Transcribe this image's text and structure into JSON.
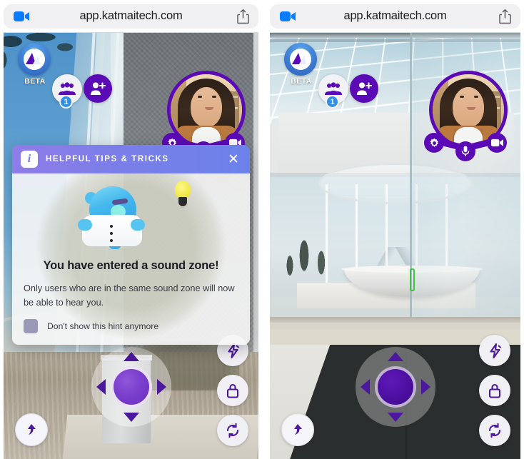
{
  "browser": {
    "url": "app.katmaitech.com",
    "camera_icon": "video-camera-icon",
    "share_icon": "share-icon"
  },
  "hud": {
    "brand_label": "BETA",
    "brand_icon": "mountain-logo-icon",
    "people_icon": "people-group-icon",
    "people_count": "1",
    "invite_icon": "add-person-icon",
    "selfview_label": "self-view-video",
    "controls": [
      {
        "name": "settings-button",
        "icon": "gear-icon"
      },
      {
        "name": "microphone-button",
        "icon": "microphone-icon"
      },
      {
        "name": "camera-button",
        "icon": "video-camera-icon"
      }
    ],
    "jump_icon": "jump-arrow-icon",
    "side_buttons": [
      {
        "name": "boost-button",
        "icon": "lightning-bolt-icon"
      },
      {
        "name": "lock-button",
        "icon": "padlock-icon"
      },
      {
        "name": "reset-view-button",
        "icon": "refresh-icon"
      }
    ],
    "dpad": {
      "up": "arrow-up",
      "down": "arrow-down",
      "left": "arrow-left",
      "right": "arrow-right",
      "stick": "joystick-knob"
    }
  },
  "modal": {
    "info_glyph": "i",
    "title": "HELPFUL TIPS & TRICKS",
    "close_glyph": "✕",
    "heading": "You have entered a sound zone!",
    "body": "Only users who are in the same sound zone will now be able to hear you.",
    "checkbox_label": "Don't show this hint anymore",
    "illustration": "blue-mascot-with-lightbulb"
  },
  "colors": {
    "brand_purple": "#5b0bb5",
    "accent_purple": "#4c189e",
    "modal_gradient_start": "#8f7ce8",
    "modal_gradient_end": "#6b82ea",
    "badge_blue": "#2f8fe5",
    "url_pill": "#f0f0f2"
  }
}
